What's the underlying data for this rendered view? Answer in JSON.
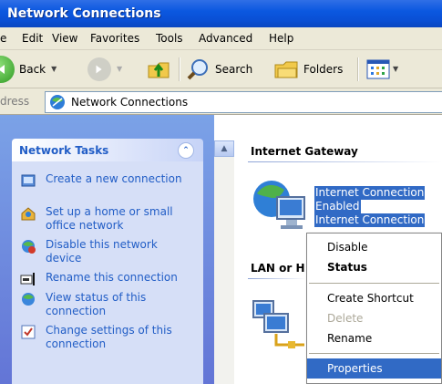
{
  "window": {
    "title": "Network Connections"
  },
  "menu": [
    "e",
    "Edit",
    "View",
    "Favorites",
    "Tools",
    "Advanced",
    "Help"
  ],
  "toolbar": {
    "back_label": "Back",
    "search_label": "Search",
    "folders_label": "Folders"
  },
  "address": {
    "label": "dress",
    "value": "Network Connections"
  },
  "left_pane": {
    "title": "Network Tasks",
    "collapse_glyph": "⌃",
    "tasks": [
      "Create a new connection",
      "Set up a home or small office network",
      "Disable this network device",
      "Rename this connection",
      "View status of this connection",
      "Change settings of this connection"
    ]
  },
  "right_pane": {
    "section1": "Internet Gateway",
    "item1_lines": [
      "Internet Connection",
      "Enabled",
      "Internet Connection"
    ],
    "section2": "LAN or H"
  },
  "context_menu": {
    "items": [
      "Disable",
      "Status",
      "Create Shortcut",
      "Delete",
      "Rename",
      "Properties"
    ]
  },
  "colors": {
    "titlebar": "#0a58e0",
    "selection": "#316ac5",
    "task_link": "#215dc6"
  }
}
